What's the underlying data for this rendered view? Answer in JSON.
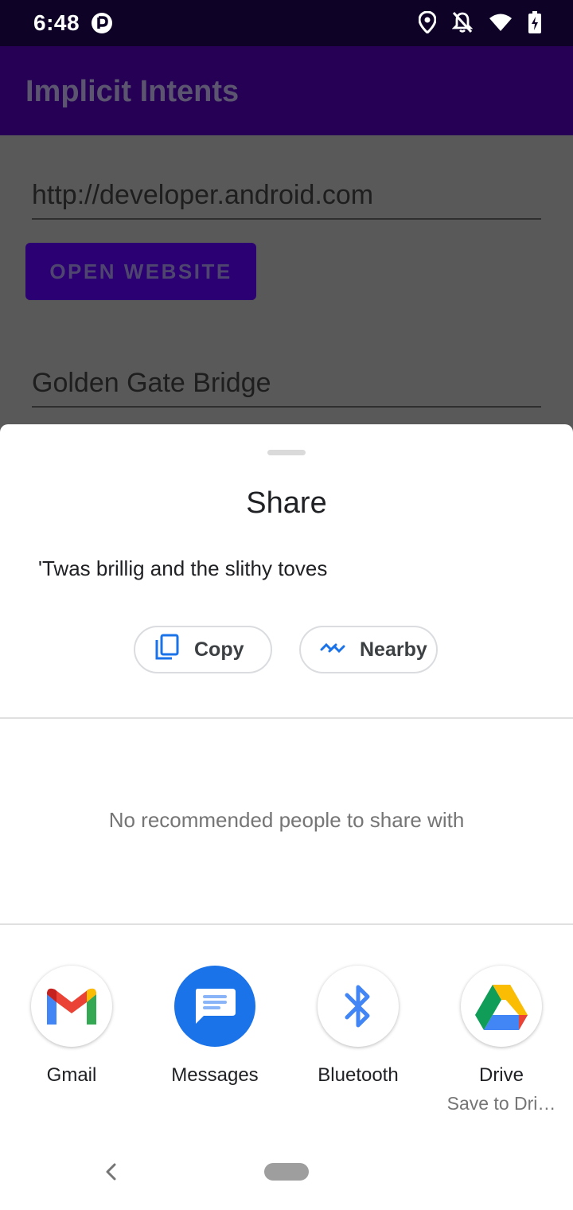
{
  "status_bar": {
    "time": "6:48",
    "icons": [
      "app-notification-icon",
      "location-icon",
      "notifications-off-icon",
      "wifi-icon",
      "battery-charging-icon"
    ]
  },
  "app_bar": {
    "title": "Implicit Intents"
  },
  "content": {
    "url_field_value": "http://developer.android.com",
    "open_website_label": "OPEN WEBSITE",
    "location_field_value": "Golden Gate Bridge"
  },
  "share_sheet": {
    "title": "Share",
    "shared_text": "'Twas brillig and the slithy toves",
    "chips": [
      {
        "label": "Copy",
        "icon": "copy-icon"
      },
      {
        "label": "Nearby",
        "icon": "nearby-share-icon"
      }
    ],
    "no_people_text": "No recommended people to share with",
    "targets": [
      {
        "label": "Gmail",
        "sub": "",
        "icon": "gmail-icon"
      },
      {
        "label": "Messages",
        "sub": "",
        "icon": "messages-icon"
      },
      {
        "label": "Bluetooth",
        "sub": "",
        "icon": "bluetooth-icon"
      },
      {
        "label": "Drive",
        "sub": "Save to Dri…",
        "icon": "drive-icon"
      }
    ]
  },
  "colors": {
    "status_bar": "#0e0326",
    "app_bar": "#260055",
    "button": "#2b0072",
    "accent_blue": "#1a73e8"
  }
}
